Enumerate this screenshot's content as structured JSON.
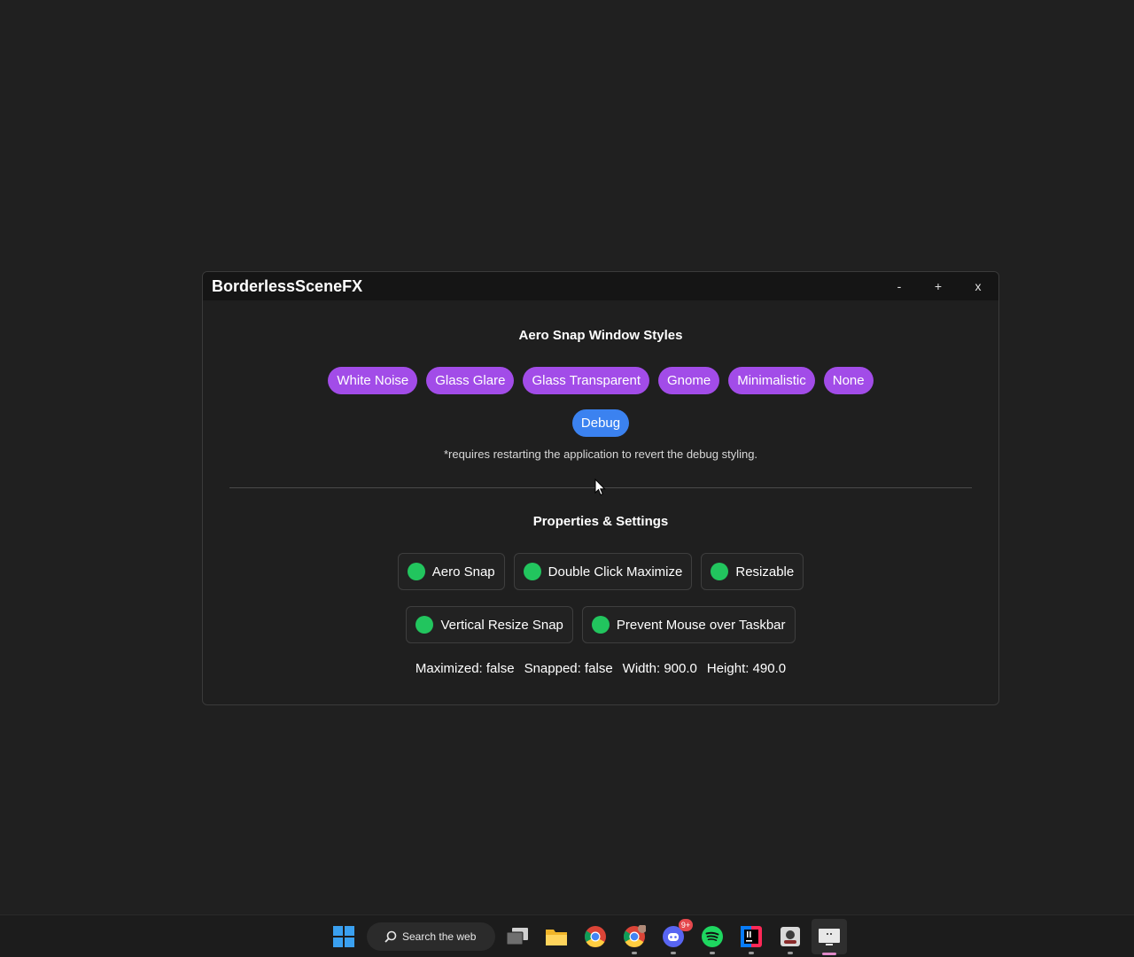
{
  "window": {
    "title": "BorderlessSceneFX",
    "controls": {
      "minimize": "-",
      "maximize": "+",
      "close": "x"
    }
  },
  "styles_section": {
    "title": "Aero Snap Window Styles",
    "buttons": [
      "White Noise",
      "Glass Glare",
      "Glass Transparent",
      "Gnome",
      "Minimalistic",
      "None"
    ],
    "debug_button": "Debug",
    "note": "*requires restarting the application to revert the debug styling."
  },
  "properties_section": {
    "title": "Properties & Settings",
    "toggles_row1": [
      "Aero Snap",
      "Double Click Maximize",
      "Resizable"
    ],
    "toggles_row2": [
      "Vertical Resize Snap",
      "Prevent Mouse over Taskbar"
    ],
    "toggle_state": "on",
    "status": {
      "maximized": "Maximized: false",
      "snapped": "Snapped: false",
      "width": "Width: 900.0",
      "height": "Height: 490.0"
    }
  },
  "taskbar": {
    "search_text": "Search the web",
    "discord_badge": "9+",
    "icons": [
      "start-icon",
      "search-icon",
      "task-view-icon",
      "file-explorer-icon",
      "chrome-icon",
      "chrome-profile-icon",
      "discord-icon",
      "spotify-icon",
      "intellij-icon",
      "java-app-icon",
      "active-app-icon"
    ]
  },
  "colors": {
    "pill_purple": "#a24ce8",
    "pill_blue": "#3b82f0",
    "toggle_on": "#22c55e",
    "background": "#202020"
  }
}
